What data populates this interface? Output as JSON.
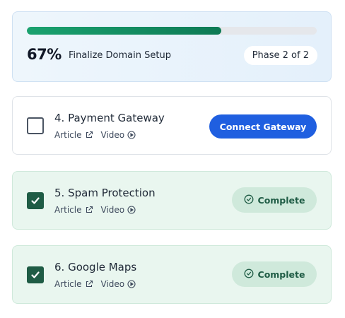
{
  "progress": {
    "percent_value": 0.67,
    "percent_label": "67%",
    "title": "Finalize Domain Setup",
    "phase": "Phase 2 of 2",
    "fill_color": "#0e7a55"
  },
  "tasks": [
    {
      "title": "4. Payment Gateway",
      "article_label": "Article",
      "video_label": "Video",
      "completed": false,
      "action_label": "Connect Gateway"
    },
    {
      "title": "5. Spam Protection",
      "article_label": "Article",
      "video_label": "Video",
      "completed": true,
      "status_label": "Complete"
    },
    {
      "title": "6. Google Maps",
      "article_label": "Article",
      "video_label": "Video",
      "completed": true,
      "status_label": "Complete"
    }
  ],
  "colors": {
    "accent_blue": "#1f5fe0",
    "complete_green": "#1f5c45",
    "complete_bg": "#e9f6ef"
  },
  "icons": {
    "article": "external-link-icon",
    "video": "play-circle-icon",
    "complete": "check-circle-icon",
    "checkbox": "checkmark-icon"
  }
}
